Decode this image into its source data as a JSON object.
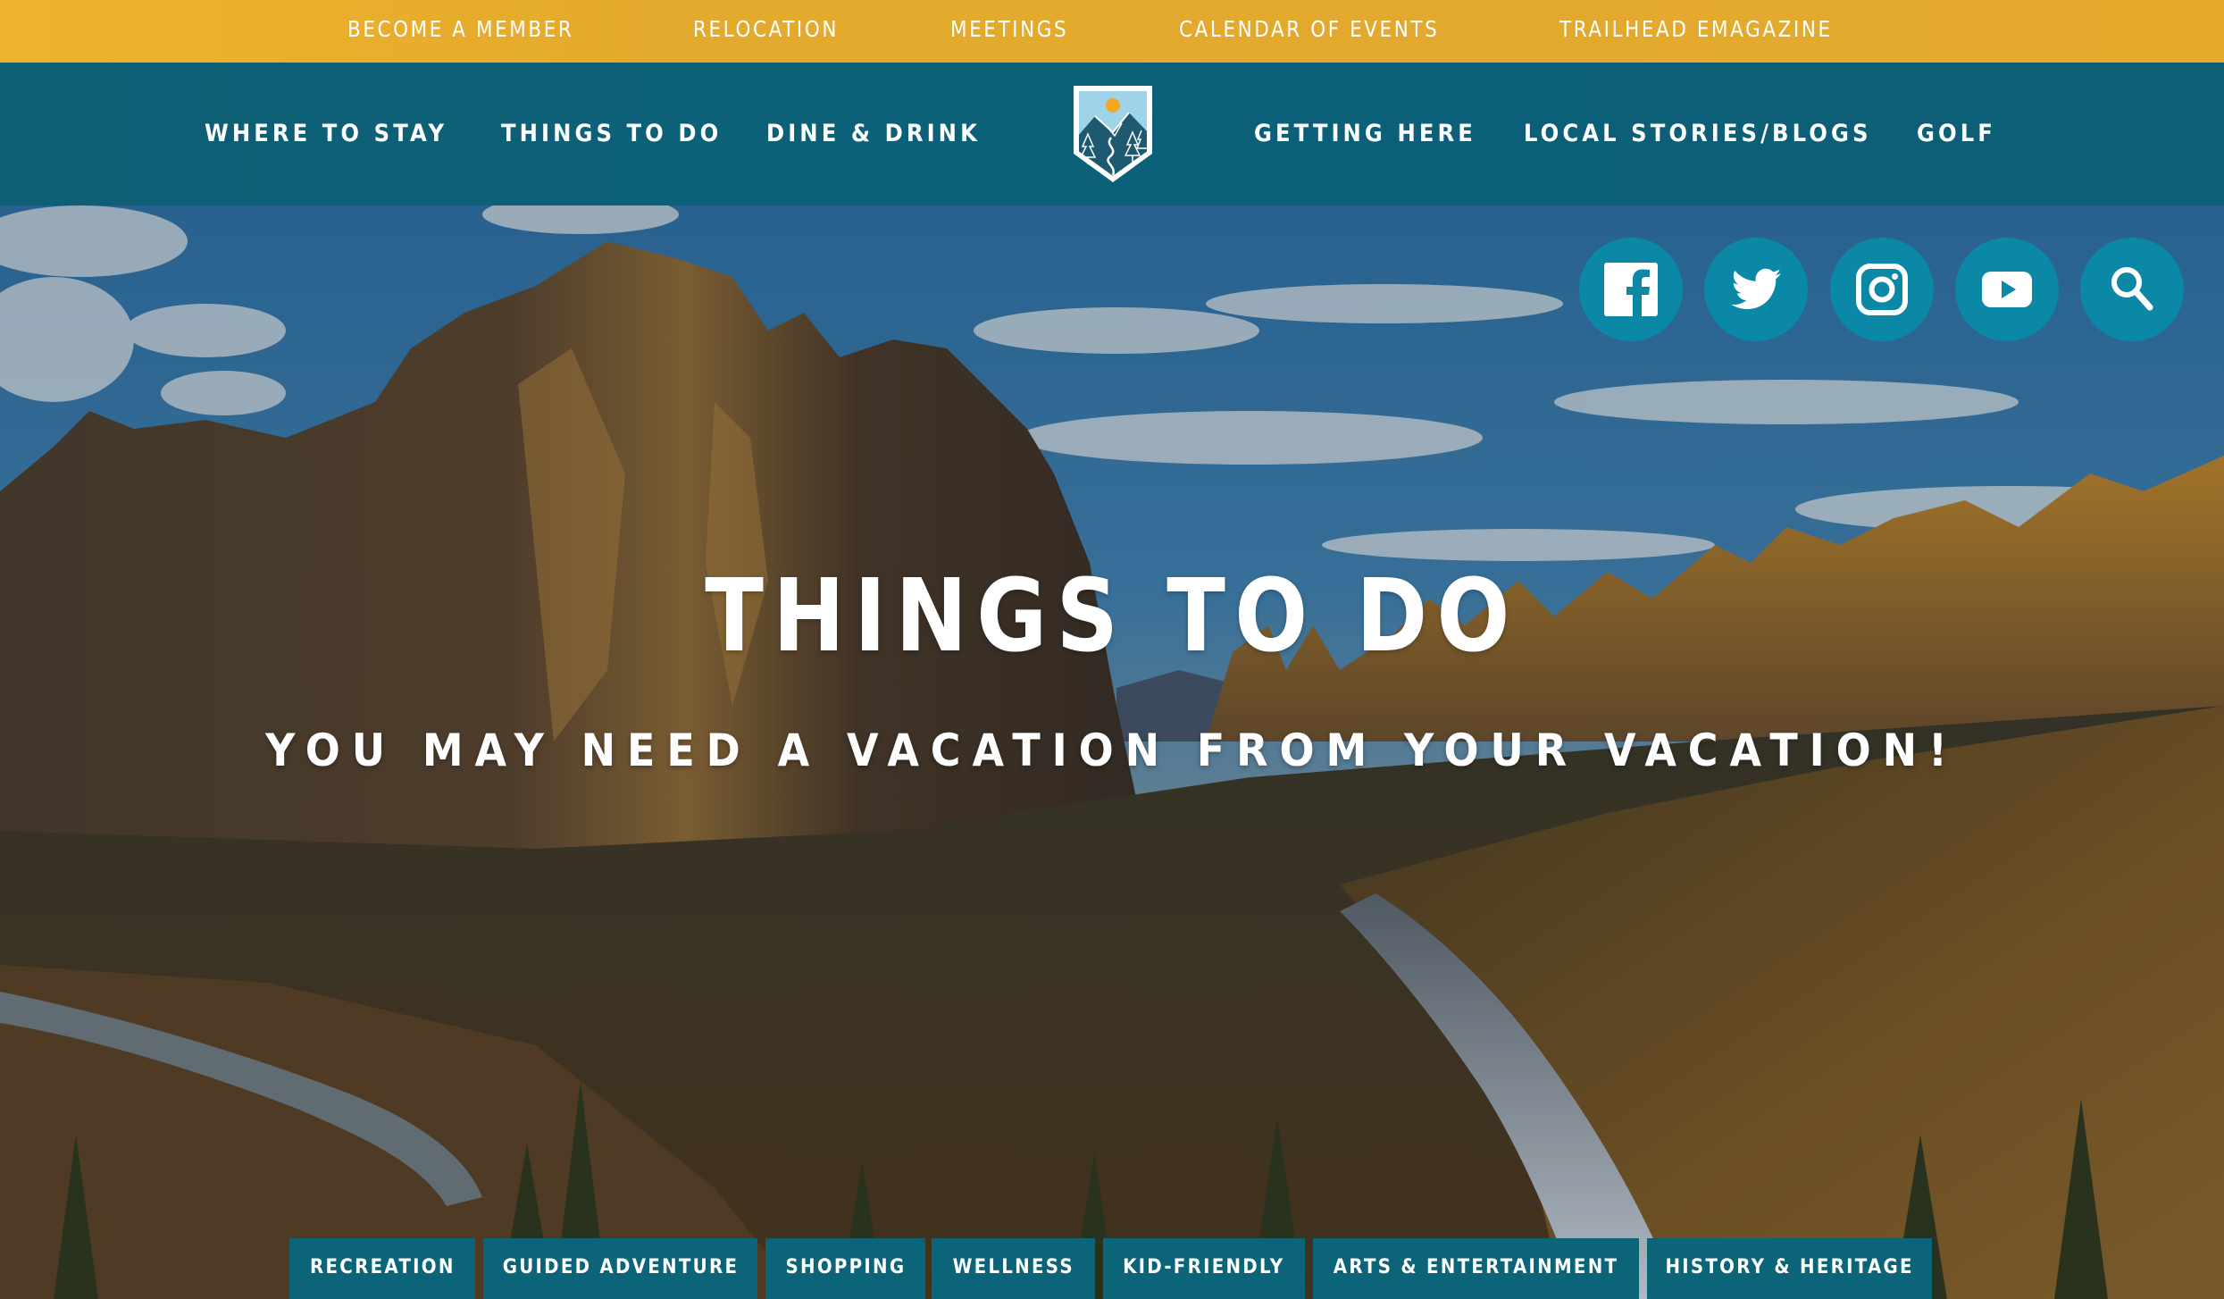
{
  "utility_nav": {
    "items": [
      {
        "label": "BECOME A MEMBER"
      },
      {
        "label": "RELOCATION"
      },
      {
        "label": "MEETINGS"
      },
      {
        "label": "CALENDAR OF EVENTS"
      },
      {
        "label": "TRAILHEAD EMAGAZINE"
      }
    ]
  },
  "main_nav": {
    "left": [
      {
        "label": "WHERE TO STAY"
      },
      {
        "label": "THINGS TO DO"
      },
      {
        "label": "DINE & DRINK"
      }
    ],
    "right": [
      {
        "label": "GETTING HERE"
      },
      {
        "label": "LOCAL STORIES/BLOGS"
      },
      {
        "label": "GOLF"
      }
    ],
    "logo": {
      "icon": "mountain-shield-logo"
    }
  },
  "social": [
    {
      "name": "facebook",
      "icon": "facebook-icon"
    },
    {
      "name": "twitter",
      "icon": "twitter-icon"
    },
    {
      "name": "instagram",
      "icon": "instagram-icon"
    },
    {
      "name": "youtube",
      "icon": "youtube-icon"
    },
    {
      "name": "search",
      "icon": "search-icon"
    }
  ],
  "hero": {
    "title": "THINGS TO DO",
    "subtitle": "YOU MAY NEED A VACATION FROM YOUR VACATION!"
  },
  "categories": [
    {
      "label": "RECREATION"
    },
    {
      "label": "GUIDED ADVENTURE"
    },
    {
      "label": "SHOPPING"
    },
    {
      "label": "WELLNESS"
    },
    {
      "label": "KID-FRIENDLY"
    },
    {
      "label": "ARTS & ENTERTAINMENT"
    },
    {
      "label": "HISTORY & HERITAGE"
    }
  ],
  "colors": {
    "utility_bar": "#e4aa2d",
    "main_nav": "#0c6078",
    "social_circle": "#0a88a6",
    "category_tab": "#0c6478",
    "text": "#ffffff"
  }
}
